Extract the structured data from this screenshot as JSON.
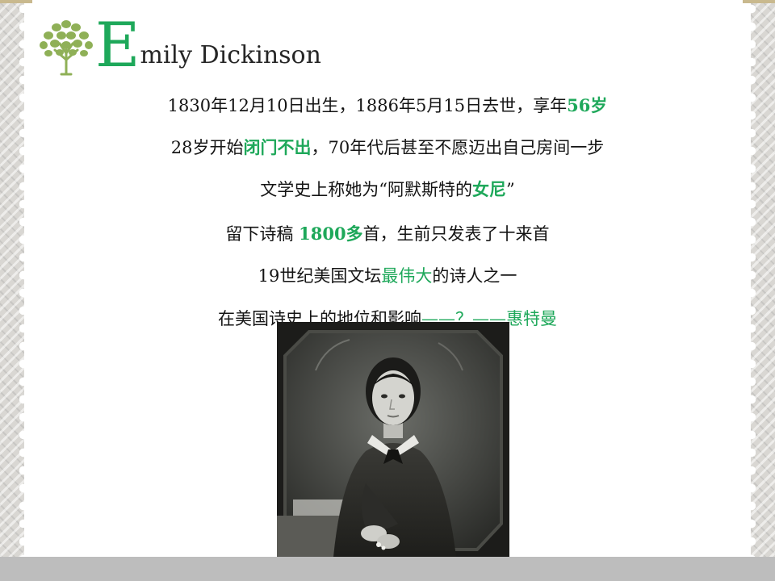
{
  "title": {
    "initial": "E",
    "rest": "mily Dickinson"
  },
  "lines": [
    [
      {
        "text": "1830年12月10日出生，1886年5月15日去世，享年"
      },
      {
        "text": "56岁",
        "hl": true,
        "bold": true
      }
    ],
    [
      {
        "text": "28岁开始"
      },
      {
        "text": "闭门不出",
        "hl": true,
        "bold": true
      },
      {
        "text": "，70年代后甚至不愿迈出自己房间一步"
      }
    ],
    [
      {
        "text": "文学史上称她为“阿默斯特的"
      },
      {
        "text": "女尼",
        "hl": true,
        "bold": true
      },
      {
        "text": "”"
      }
    ],
    [
      {
        "text": "留下诗稿  "
      },
      {
        "text": "1800多",
        "hl": true,
        "bold": true
      },
      {
        "text": "首，生前只发表了十来首"
      }
    ],
    [
      {
        "text": "19世纪美国文坛"
      },
      {
        "text": "最伟大",
        "hl": true
      },
      {
        "text": "的诗人之一"
      }
    ],
    [
      {
        "text": "在美国诗史上的地位和影响"
      },
      {
        "text": "——？——惠特曼",
        "hl": true
      }
    ]
  ],
  "colors": {
    "accent": "#1ea85a",
    "text": "#141414",
    "border": "#d9d7d3",
    "bottom_bar": "#bdbdbd"
  },
  "icons": {
    "logo": "tree-icon"
  },
  "image": {
    "subject": "portrait-photo"
  }
}
